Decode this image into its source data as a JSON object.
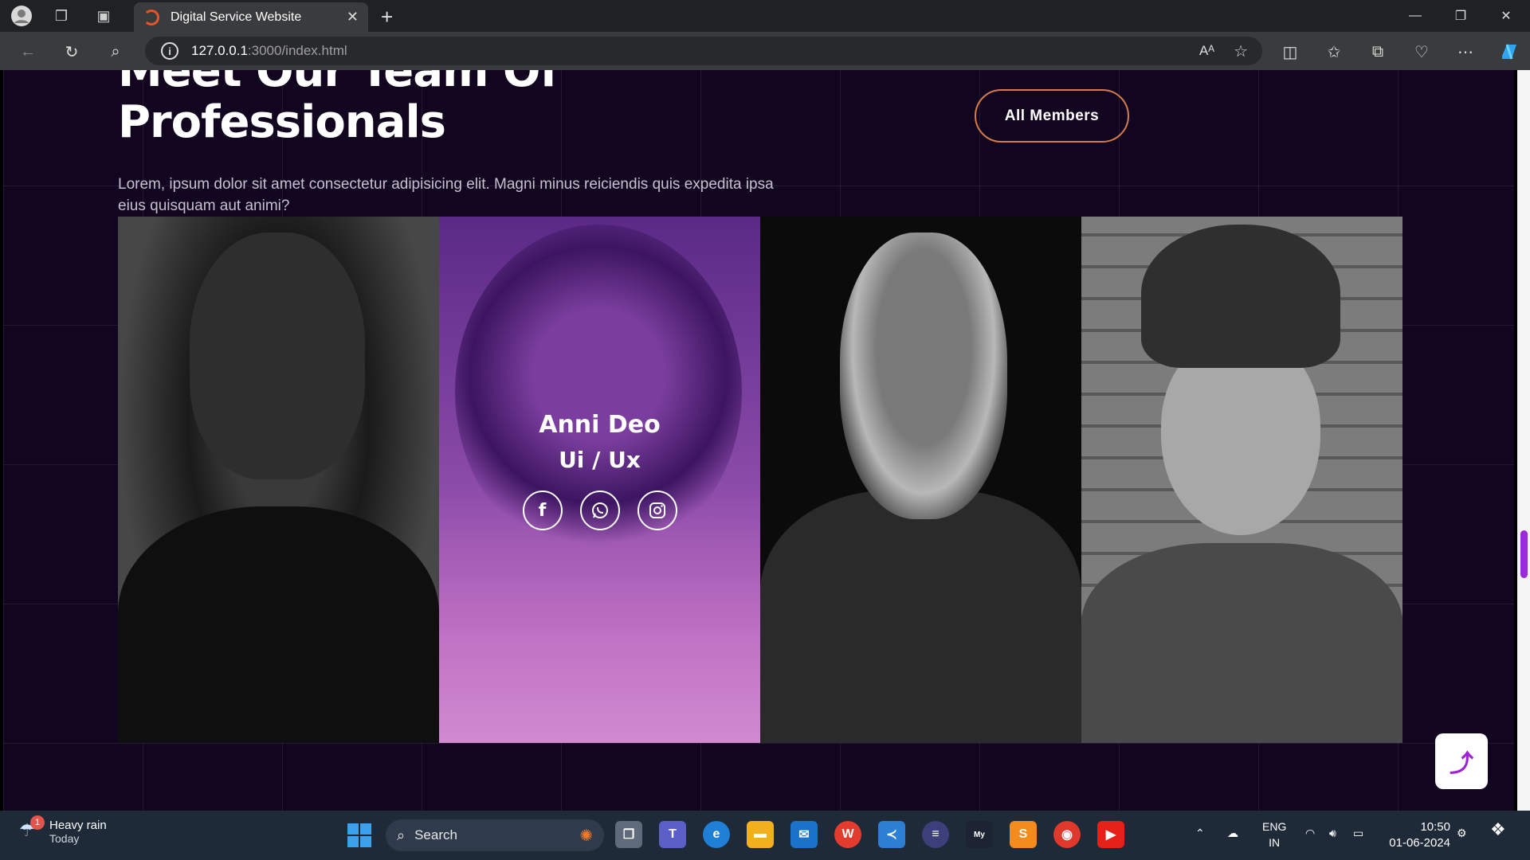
{
  "browser": {
    "tab_title": "Digital Service Website",
    "url_host": "127.0.0.1",
    "url_path": ":3000/index.html"
  },
  "page": {
    "heading": "Meet Our Team Of Professionals",
    "description": "Lorem, ipsum dolor sit amet consectetur adipisicing elit. Magni minus reiciendis quis expedita ipsa eius quisquam aut animi?",
    "all_members_label": "All Members",
    "featured_member": {
      "name": "Anni Deo",
      "role": "Ui / Ux"
    },
    "socials": [
      "facebook-icon",
      "whatsapp-icon",
      "instagram-icon"
    ],
    "scroll_top_glyph": "⤴"
  },
  "taskbar": {
    "weather_title": "Heavy rain",
    "weather_sub": "Today",
    "weather_badge": "1",
    "search_placeholder": "Search",
    "lang_top": "ENG",
    "lang_bottom": "IN",
    "time": "10:50",
    "date": "01-06-2024"
  },
  "colors": {
    "page_bg": "#12051f",
    "accent_border": "#d67b4a",
    "accent_purple": "#9b2ad8"
  }
}
